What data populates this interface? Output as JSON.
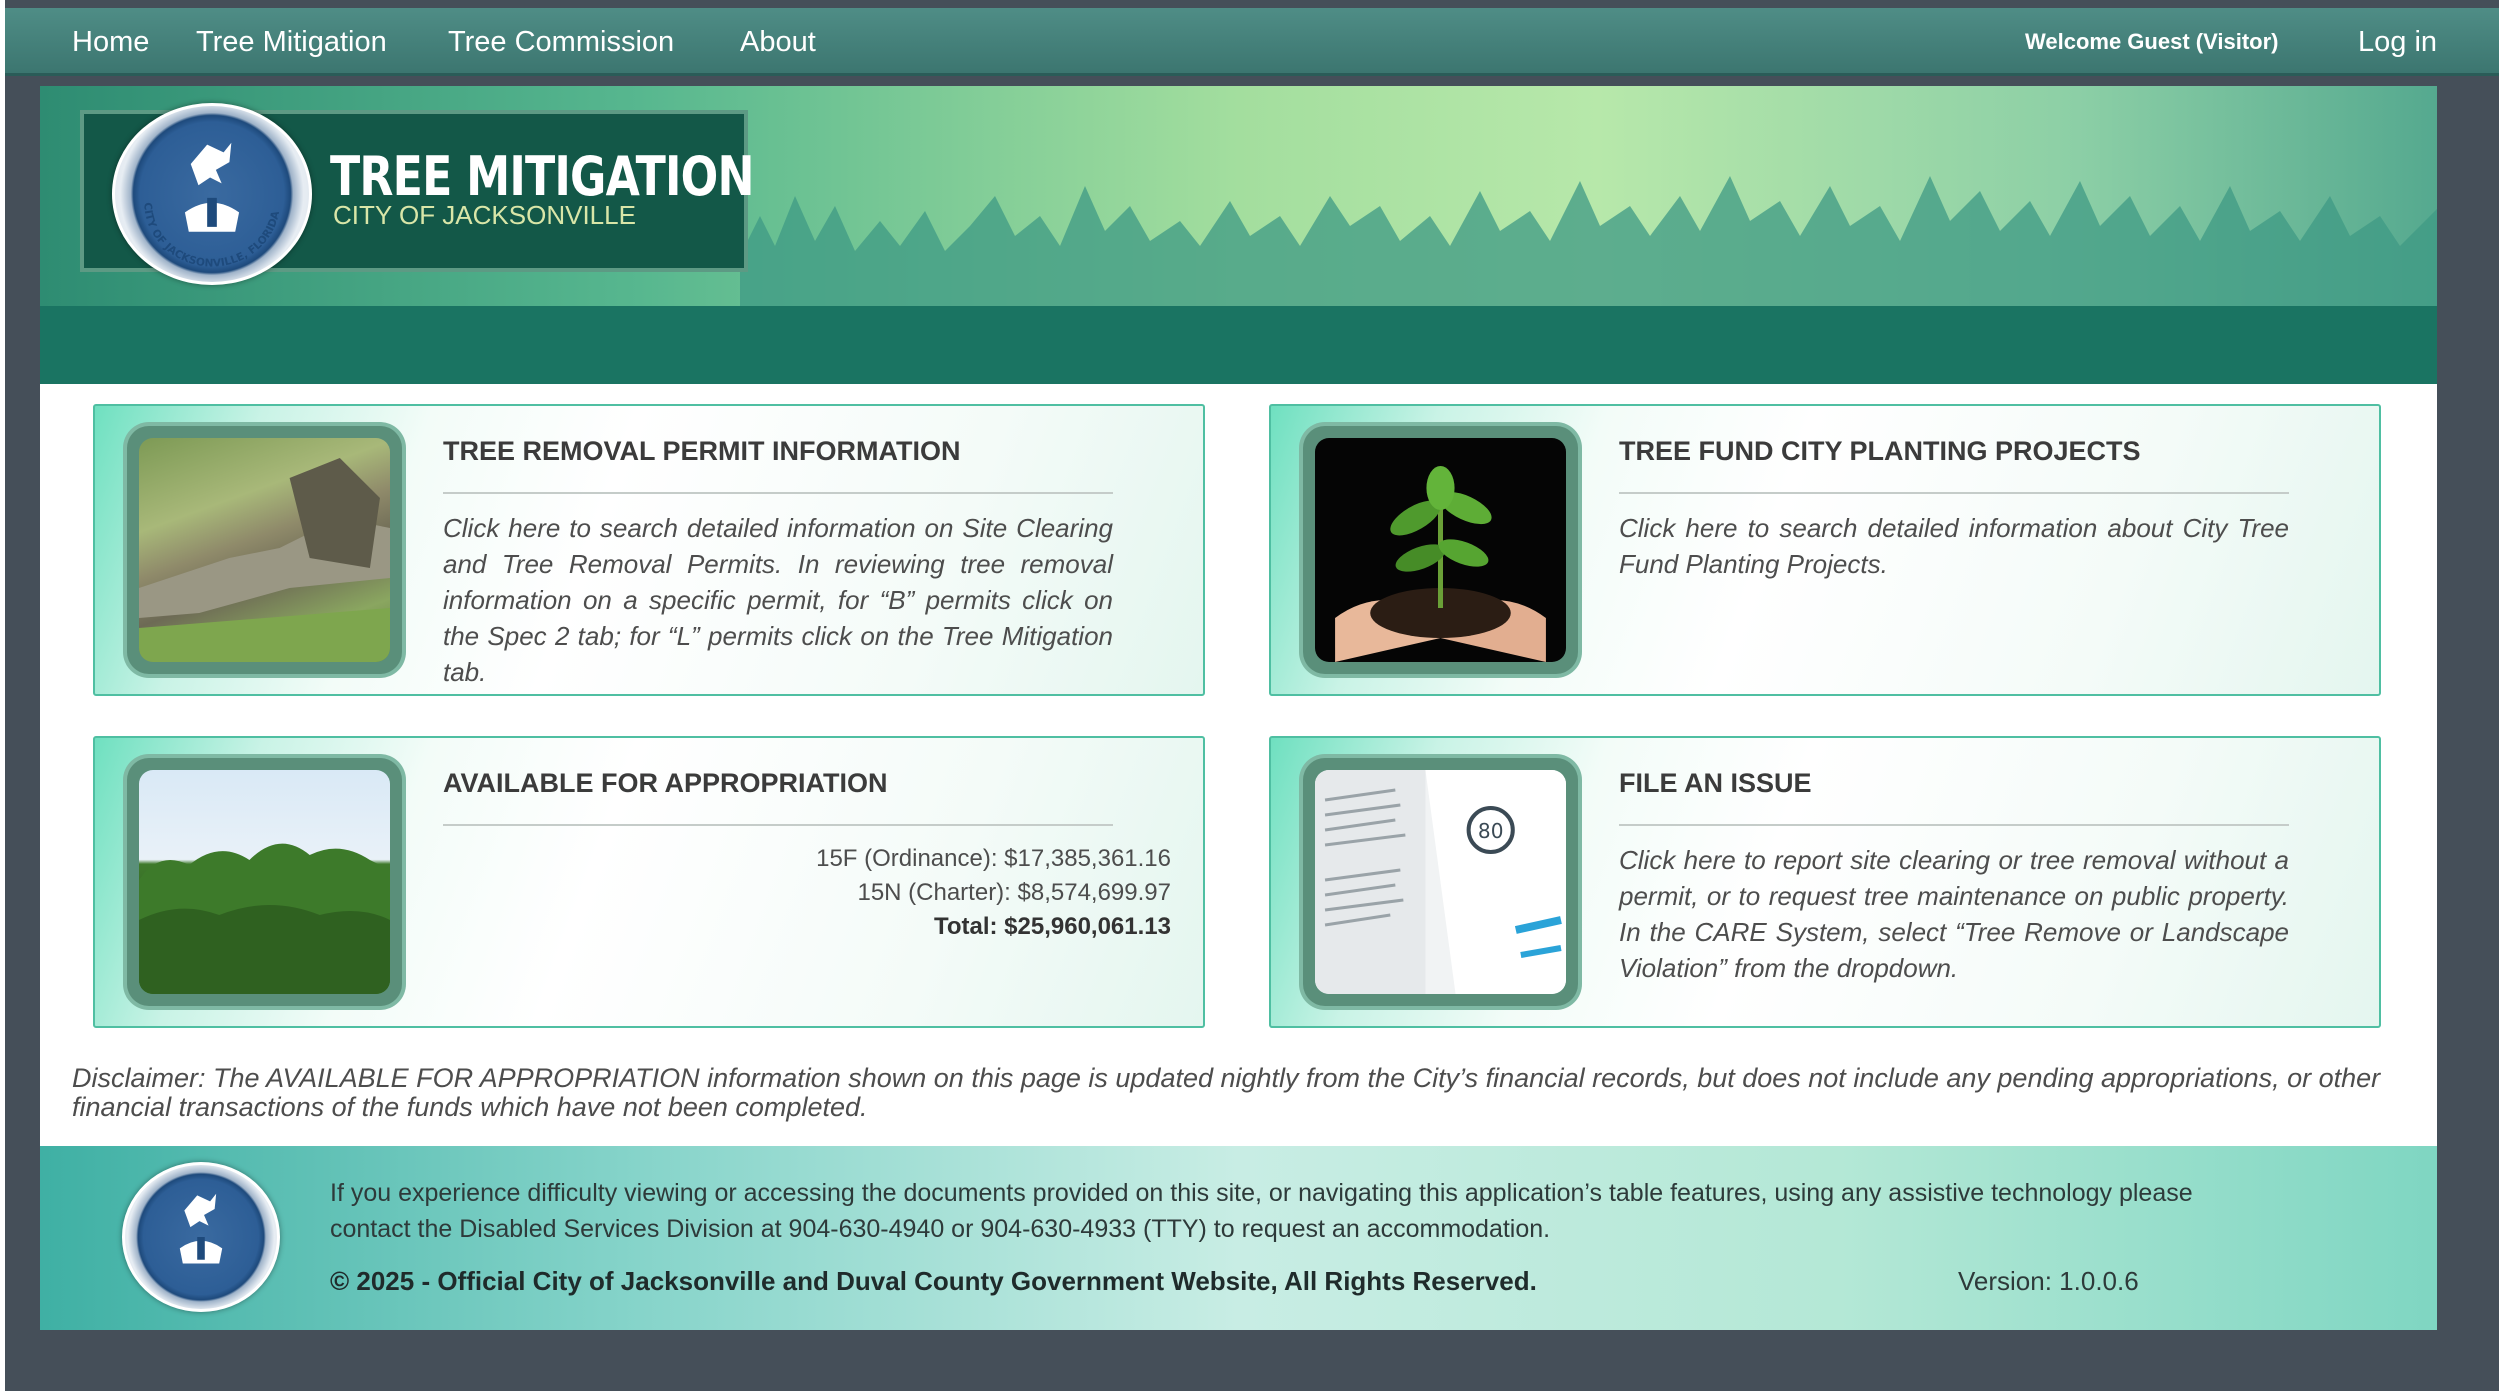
{
  "nav": {
    "home": "Home",
    "tree_mitigation": "Tree Mitigation",
    "tree_commission": "Tree Commission",
    "about": "About",
    "welcome": "Welcome Guest (Visitor)",
    "login": "Log in"
  },
  "header": {
    "title": "TREE MITIGATION",
    "subtitle": "CITY OF JACKSONVILLE",
    "seal_text": "CITY OF JACKSONVILLE, FLORIDA"
  },
  "cards": {
    "removal": {
      "title": "TREE REMOVAL PERMIT INFORMATION",
      "text": "Click here to search detailed information on Site Clearing and Tree Removal Permits. In reviewing tree removal information on a specific permit, for “B” permits click on the Spec 2 tab; for “L” permits click on the Tree Mitigation tab."
    },
    "fund": {
      "title": "TREE FUND CITY PLANTING PROJECTS",
      "text": "Click here to search detailed information about City Tree Fund Planting Projects."
    },
    "appropriation": {
      "title": "AVAILABLE FOR APPROPRIATION",
      "ordinance": "15F (Ordinance): $17,385,361.16",
      "charter": "15N (Charter): $8,574,699.97",
      "total": "Total: $25,960,061.13"
    },
    "issue": {
      "title": "FILE AN ISSUE",
      "text": "Click here to report site clearing or tree removal without a permit, or to request tree maintenance on public property. In the CARE System, select “Tree Remove or Landscape Violation” from the dropdown.",
      "doc_number": "80"
    }
  },
  "disclaimer": "Disclaimer: The AVAILABLE FOR APPROPRIATION information shown on this page is updated nightly from the City’s financial records, but does not include any pending appropriations, or other financial transactions of the funds which have not been completed.",
  "footer": {
    "accessibility": "If you experience difficulty viewing or accessing the documents provided on this site, or navigating this application’s table features, using any assistive technology please contact the Disabled Services Division at 904-630-4940 or 904-630-4933 (TTY) to request an accommodation.",
    "copyright": "© 2025 - Official City of Jacksonville and Duval County Government Website, All Rights Reserved.",
    "version": "Version: 1.0.0.6"
  },
  "colors": {
    "nav_bg": "#3c7670",
    "banner_dark": "#1a7462",
    "frame": "#454f59",
    "card_border": "#4fbfa2"
  }
}
